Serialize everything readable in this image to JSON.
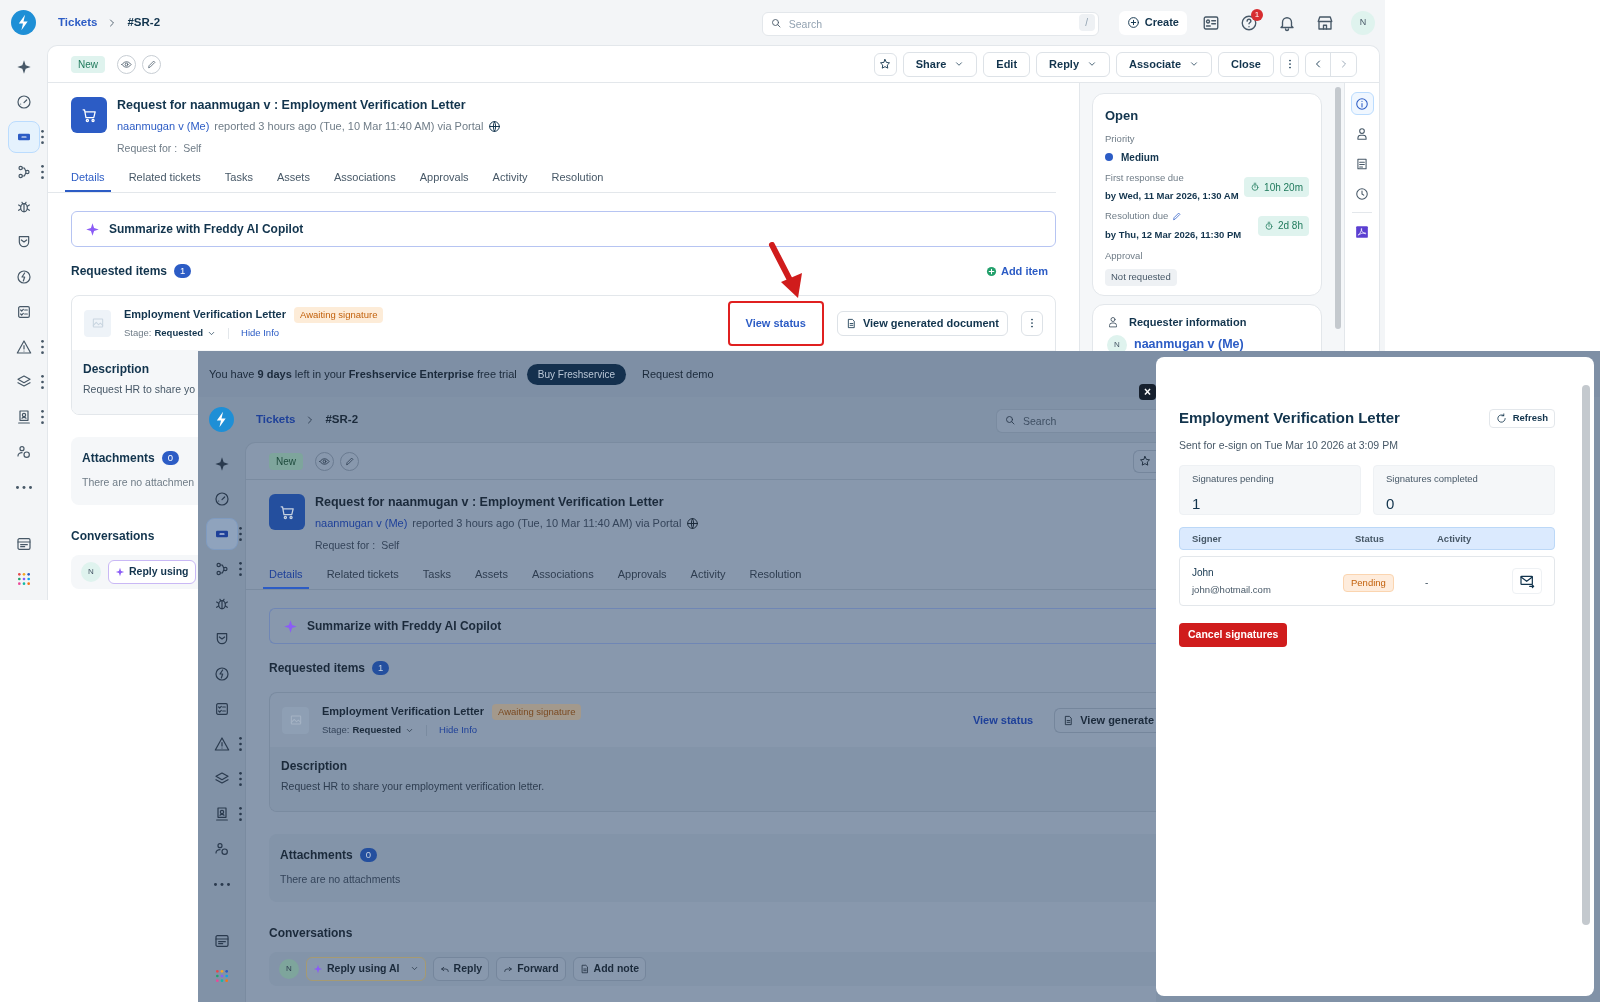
{
  "background_screen": {
    "topbar": {
      "breadcrumb": [
        "Tickets",
        "#SR-2"
      ],
      "search": {
        "placeholder": "Search",
        "shortcut": "/"
      },
      "create_button": "Create",
      "help_badge": "1",
      "avatar": "N"
    },
    "sidebar": {
      "items": [
        {
          "selected": false,
          "menu": false
        },
        {
          "selected": false,
          "menu": false
        },
        {
          "selected": true,
          "menu": true
        },
        {
          "selected": false,
          "menu": true
        },
        {
          "selected": false,
          "menu": false
        },
        {
          "selected": false,
          "menu": false
        },
        {
          "selected": false,
          "menu": false
        },
        {
          "selected": false,
          "menu": false
        },
        {
          "selected": false,
          "menu": true
        },
        {
          "selected": false,
          "menu": true
        },
        {
          "selected": false,
          "menu": true
        },
        {
          "selected": false,
          "menu": false
        },
        {
          "selected": false,
          "menu": false
        }
      ],
      "footer_items": [
        {
          "selected": false
        },
        {
          "selected": false
        }
      ]
    },
    "toolbar": {
      "status_badge": "New",
      "buttons": [
        {
          "label": "Share",
          "dropdown": true
        },
        {
          "label": "Edit",
          "dropdown": false
        },
        {
          "label": "Reply",
          "dropdown": true
        },
        {
          "label": "Associate",
          "dropdown": true
        },
        {
          "label": "Close",
          "dropdown": false
        }
      ],
      "more_menu": true,
      "pager": true
    },
    "ticket": {
      "title": "Request for naanmugan v : Employment Verification Letter",
      "requester": "naanmugan v (Me)",
      "reported": "reported 3 hours ago (Tue, 10 Mar 11:40 AM) via Portal",
      "request_for_label": "Request for :",
      "request_for": "Self"
    },
    "tabs": [
      {
        "label": "Details",
        "selected": true
      },
      {
        "label": "Related tickets",
        "selected": false
      },
      {
        "label": "Tasks",
        "selected": false
      },
      {
        "label": "Assets",
        "selected": false
      },
      {
        "label": "Associations",
        "selected": false
      },
      {
        "label": "Approvals",
        "selected": false
      },
      {
        "label": "Activity",
        "selected": false
      },
      {
        "label": "Resolution",
        "selected": false
      }
    ],
    "copilot": "Summarize with Freddy AI Copilot",
    "requested_items": {
      "title": "Requested items",
      "count": "1",
      "add_item": "Add item"
    },
    "item": {
      "name": "Employment Verification Letter",
      "badge": "Awaiting signature",
      "stage_label": "Stage:",
      "stage": "Requested",
      "hide_info": "Hide Info",
      "view_status": {
        "label": "View status",
        "highlighted": true
      },
      "view_document": "View generated document",
      "more_menu": true
    },
    "description": {
      "title": "Description",
      "text": "Request HR to share yo"
    },
    "attachments": {
      "title": "Attachments",
      "count": "0",
      "text": "There are no attachmen"
    },
    "conversations": {
      "title": "Conversations",
      "avatar": "N",
      "actions": [
        {
          "label": "Reply using",
          "kind": "ai"
        }
      ]
    },
    "side_panel": {
      "status": "Open",
      "priority_label": "Priority",
      "priority": "Medium",
      "first_response": {
        "label": "First response due",
        "due": "by Wed, 11 Mar 2026, 1:30 AM",
        "timer": "10h 20m",
        "editable": false
      },
      "resolution": {
        "label": "Resolution due",
        "due": "by Thu, 12 Mar 2026, 11:30 PM",
        "timer": "2d 8h",
        "editable": true
      },
      "approval_label": "Approval",
      "approval": "Not requested",
      "requester": {
        "title": "Requester information",
        "avatar": "N",
        "name": "naanmugan v (Me)"
      }
    },
    "right_rail": [
      {
        "selected": true
      },
      {
        "selected": false
      },
      {
        "selected": false
      },
      {
        "selected": false
      },
      {
        "selected": false
      }
    ]
  },
  "overlay_screen": {
    "banner": {
      "text": "You have **9 days** left in your **Freshservice Enterprise** free trial",
      "buy_button": "Buy Freshservice",
      "demo_link": "Request demo",
      "close": "×"
    },
    "topbar": {
      "breadcrumb": [
        "Tickets",
        "#SR-2"
      ],
      "search": {
        "placeholder": "Search"
      }
    },
    "sidebar": {
      "items": [
        {
          "selected": false,
          "menu": false
        },
        {
          "selected": false,
          "menu": false
        },
        {
          "selected": true,
          "menu": true
        },
        {
          "selected": false,
          "menu": true
        },
        {
          "selected": false,
          "menu": false
        },
        {
          "selected": false,
          "menu": false
        },
        {
          "selected": false,
          "menu": false
        },
        {
          "selected": false,
          "menu": false
        },
        {
          "selected": false,
          "menu": true
        },
        {
          "selected": false,
          "menu": true
        },
        {
          "selected": false,
          "menu": true
        },
        {
          "selected": false,
          "menu": false
        },
        {
          "selected": false,
          "menu": false
        }
      ],
      "footer_items": [
        {
          "selected": false
        },
        {
          "selected": false
        }
      ]
    },
    "toolbar": {
      "status_badge": "New"
    },
    "ticket": {
      "title": "Request for naanmugan v : Employment Verification Letter",
      "requester": "naanmugan v (Me)",
      "reported": "reported 3 hours ago (Tue, 10 Mar 11:40 AM) via Portal",
      "request_for_label": "Request for :",
      "request_for": "Self"
    },
    "tabs": [
      {
        "label": "Details",
        "selected": true
      },
      {
        "label": "Related tickets",
        "selected": false
      },
      {
        "label": "Tasks",
        "selected": false
      },
      {
        "label": "Assets",
        "selected": false
      },
      {
        "label": "Associations",
        "selected": false
      },
      {
        "label": "Approvals",
        "selected": false
      },
      {
        "label": "Activity",
        "selected": false
      },
      {
        "label": "Resolution",
        "selected": false
      }
    ],
    "copilot": "Summarize with Freddy AI Copilot",
    "requested_items": {
      "title": "Requested items",
      "count": "1"
    },
    "item": {
      "name": "Employment Verification Letter",
      "badge": "Awaiting signature",
      "stage_label": "Stage:",
      "stage": "Requested",
      "hide_info": "Hide Info",
      "view_status": {
        "label": "View status",
        "highlighted": false
      },
      "view_document": "View generate",
      "more_menu": false
    },
    "description": {
      "title": "Description",
      "text": "Request HR to share your employment verification letter."
    },
    "attachments": {
      "title": "Attachments",
      "count": "0",
      "text": "There are no attachments"
    },
    "conversations": {
      "title": "Conversations",
      "avatar": "N",
      "actions": [
        {
          "label": "Reply using AI",
          "kind": "ai",
          "dropdown": true
        },
        {
          "label": "Reply",
          "kind": "reply",
          "dropdown": false
        },
        {
          "label": "Forward",
          "kind": "forward",
          "dropdown": false
        },
        {
          "label": "Add note",
          "kind": "note",
          "dropdown": false
        }
      ]
    },
    "signature_panel": {
      "title": "Employment Verification Letter",
      "refresh": "Refresh",
      "sent": "Sent for e-sign on Tue Mar 10 2026 at 3:09 PM",
      "stats": [
        {
          "label": "Signatures pending",
          "value": "1"
        },
        {
          "label": "Signatures completed",
          "value": "0"
        }
      ],
      "columns": [
        "Signer",
        "Status",
        "Activity"
      ],
      "signers": [
        {
          "name": "John",
          "email": "john@hotmail.com",
          "status": "Pending",
          "kind": "pending",
          "activity": "-"
        }
      ],
      "cancel_button": "Cancel signatures"
    }
  }
}
